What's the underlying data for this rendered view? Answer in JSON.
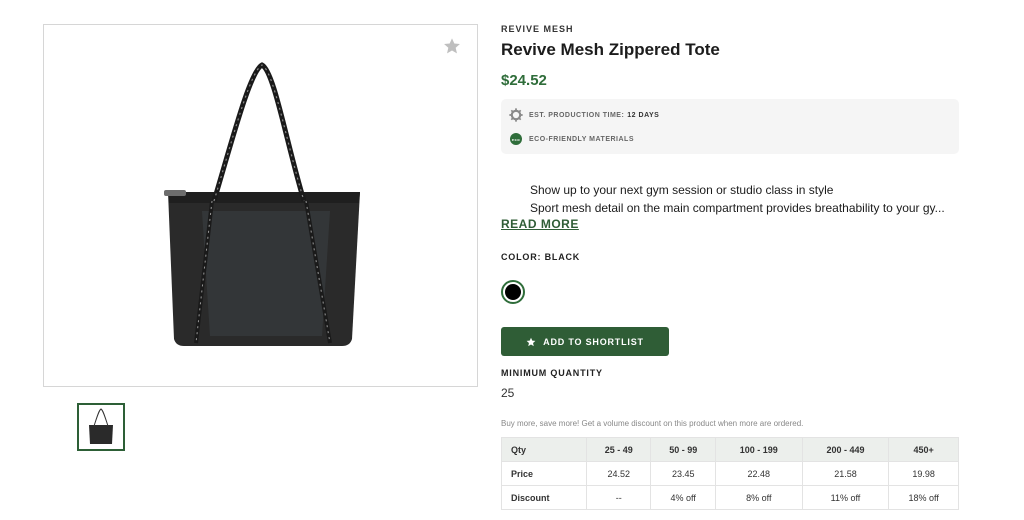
{
  "product": {
    "brand": "REVIVE MESH",
    "title": "Revive Mesh Zippered Tote",
    "price": "$24.52",
    "production_label": "EST. PRODUCTION TIME:",
    "production_value": "12 DAYS",
    "eco_label": "ECO-FRIENDLY MATERIALS",
    "eco_badge_text": "eco",
    "bullets": [
      "Show up to your next gym session or studio class in style",
      "Sport mesh detail on the main compartment provides breathability to your gy..."
    ],
    "read_more": "READ MORE",
    "color_label": "COLOR: BLACK",
    "color_hex": "#000000",
    "add_button": "ADD TO SHORTLIST",
    "min_label": "MINIMUM QUANTITY",
    "min_value": "25",
    "discount_note": "Buy more, save more! Get a volume discount on this product when more are ordered."
  },
  "pricing_table": {
    "header": [
      "Qty",
      "25 - 49",
      "50 - 99",
      "100 - 199",
      "200 - 449",
      "450+"
    ],
    "price": [
      "Price",
      "24.52",
      "23.45",
      "22.48",
      "21.58",
      "19.98"
    ],
    "discount": [
      "Discount",
      "--",
      "4% off",
      "8% off",
      "11% off",
      "18% off"
    ]
  },
  "colors": {
    "accent": "#2f5d36",
    "price": "#2f6d3a"
  },
  "icons": {
    "favorite": "star-icon",
    "production": "gear-icon",
    "eco": "eco-badge-icon",
    "add": "star-icon"
  }
}
